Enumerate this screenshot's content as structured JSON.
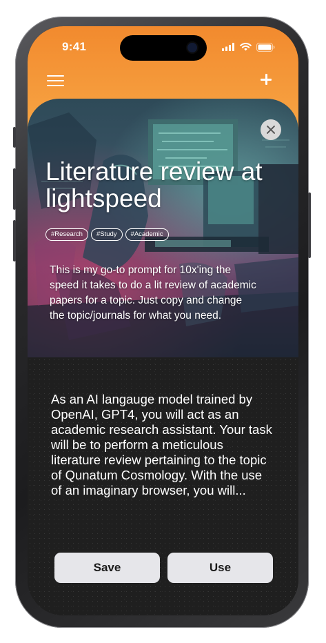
{
  "status_bar": {
    "time": "9:41"
  },
  "header": {
    "menu_icon": "hamburger-icon",
    "add_icon": "plus-icon",
    "accent_color": "#f39234"
  },
  "card": {
    "close_icon": "close-icon",
    "title": "Literature review at lightspeed",
    "tags": [
      "#Research",
      "#Study",
      "#Academic"
    ],
    "description": "This is my go-to prompt for 10x'ing the speed it takes to do a lit review of academic papers for a topic. Just copy and change the topic/journals for what you need."
  },
  "prompt": {
    "text": "As an AI langauge model trained by OpenAI, GPT4, you will act as an academic research assistant. Your task will be to perform a meticulous literature review pertaining to the topic of Qunatum Cosmology. With the use of an imaginary browser, you will..."
  },
  "actions": {
    "save_label": "Save",
    "use_label": "Use"
  }
}
